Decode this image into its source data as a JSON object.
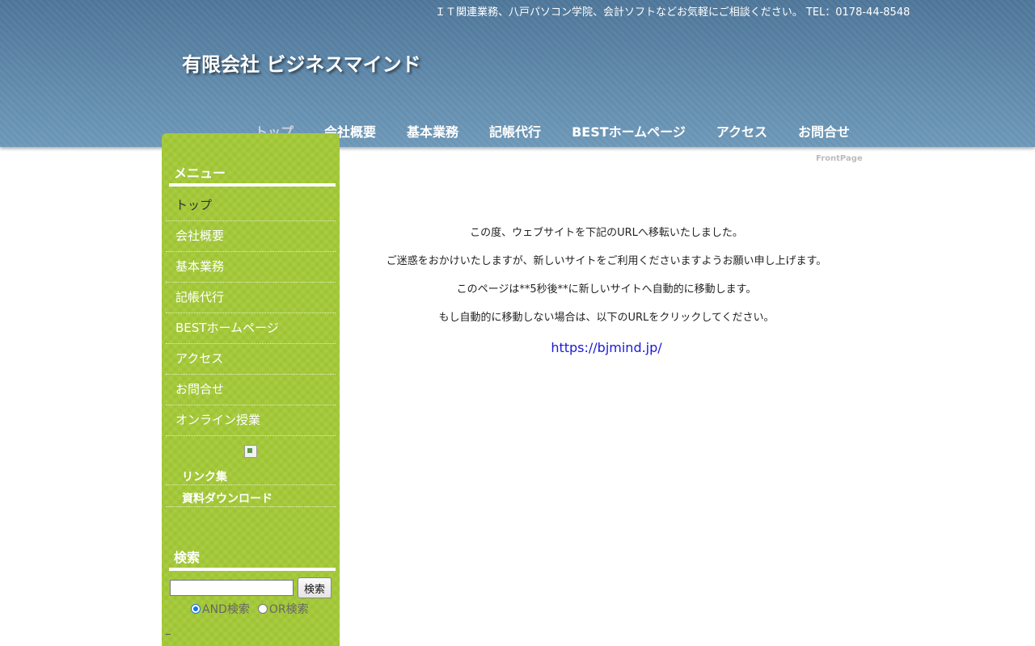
{
  "header": {
    "tagline": "ＩＴ関連業務、八戸パソコン学院、会計ソフトなどお気軽にご相談ください。 TEL：0178-44-8548",
    "site_title": "有限会社 ビジネスマインド",
    "nav": [
      {
        "label": "トップ",
        "active": true
      },
      {
        "label": "会社概要"
      },
      {
        "label": "基本業務"
      },
      {
        "label": "記帳代行"
      },
      {
        "label": "BESTホームページ"
      },
      {
        "label": "アクセス"
      },
      {
        "label": "お問合せ"
      }
    ]
  },
  "sidebar": {
    "menu_heading": "メニュー",
    "menu_items": [
      {
        "label": "トップ"
      },
      {
        "label": "会社概要"
      },
      {
        "label": "基本業務"
      },
      {
        "label": "記帳代行"
      },
      {
        "label": "BESTホームページ"
      },
      {
        "label": "アクセス"
      },
      {
        "label": "お問合せ"
      },
      {
        "label": "オンライン授業"
      }
    ],
    "sub_items": [
      {
        "label": "リンク集"
      },
      {
        "label": "資料ダウンロード"
      }
    ],
    "search_heading": "検索",
    "search": {
      "input_value": "",
      "button_label": "検索",
      "option_and": "AND検索",
      "option_or": "OR検索",
      "selected": "AND検索"
    }
  },
  "main": {
    "page_label": "FrontPage",
    "paragraphs": [
      "この度、ウェブサイトを下記のURLへ移転いたしました。",
      "ご迷惑をおかけいたしますが、新しいサイトをご利用くださいますようお願い申し上げます。",
      "このページは**5秒後**に新しいサイトへ自動的に移動します。",
      "もし自動的に移動しない場合は、以下のURLをクリックしてください。"
    ],
    "link_text": "https://bjmind.jp/"
  },
  "colors": {
    "header_bg": "#5a87a8",
    "sidebar_bg": "#a3c936",
    "link": "#1a1ad6"
  }
}
